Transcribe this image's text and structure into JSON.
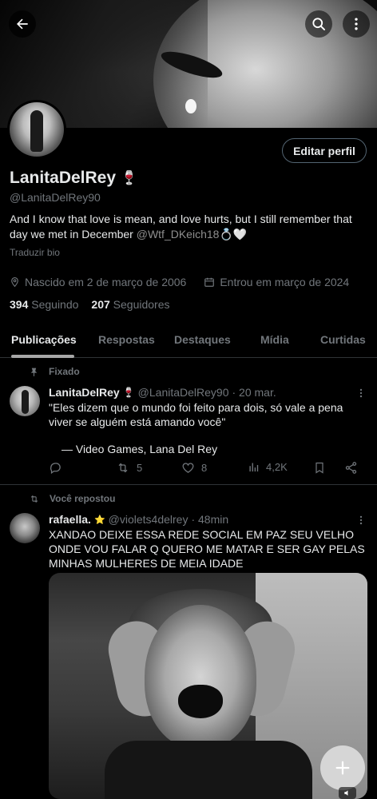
{
  "profile": {
    "display_name": "LanitaDelRey",
    "name_emoji": "🍷",
    "handle": "@LanitaDelRey90",
    "bio_text": "And I know that love is mean, and love hurts, but I still remember that day we met in December ",
    "bio_mention": "@Wtf_DKeich18",
    "bio_emoji": "💍🤍",
    "translate_label": "Traduzir bio",
    "birth": "Nascido em 2 de março de 2006",
    "joined": "Entrou em março de 2024",
    "following_count": "394",
    "following_label": "Seguindo",
    "followers_count": "207",
    "followers_label": "Seguidores",
    "edit_label": "Editar perfil"
  },
  "tabs": [
    {
      "label": "Publicações"
    },
    {
      "label": "Respostas"
    },
    {
      "label": "Destaques"
    },
    {
      "label": "Mídia"
    },
    {
      "label": "Curtidas"
    }
  ],
  "posts": [
    {
      "context": "Fixado",
      "name": "LanitaDelRey",
      "name_emoji": "🍷",
      "handle": "@LanitaDelRey90",
      "time": "· 20 mar.",
      "text": "\"Eles dizem que o mundo foi feito para dois, só vale a pena viver se alguém está amando você\"",
      "quote": "— Video Games, Lana Del Rey",
      "reposts": "5",
      "likes": "8",
      "views": "4,2K"
    },
    {
      "context": "Você repostou",
      "name": "rafaella.",
      "name_emoji": "⭐",
      "handle": "@violets4delrey",
      "time": "· 48min",
      "text": "XANDAO DEIXE ESSA REDE SOCIAL EM PAZ SEU VELHO ONDE VOU FALAR Q QUERO ME MATAR E SER GAY PELAS MINHAS MULHERES DE MEIA IDADE"
    }
  ],
  "icons": {
    "back": "arrow-left-icon",
    "search": "search-icon",
    "more": "vertical-dots-icon",
    "compose": "plus-icon"
  },
  "colors": {
    "background": "#000000",
    "text": "#e7e9ea",
    "muted": "#71767b",
    "border": "#2f3336"
  }
}
